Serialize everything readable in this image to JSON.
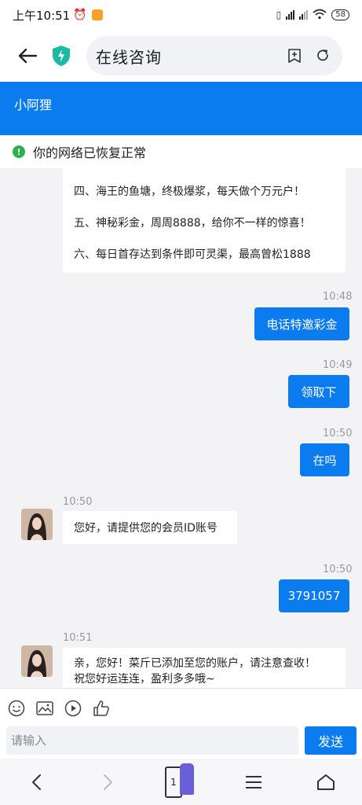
{
  "status_bar": {
    "time": "上午10:51",
    "battery": "58"
  },
  "browser": {
    "title": "在线咨询"
  },
  "chat": {
    "header_title": "小阿狸",
    "network_notice": "你的网络已恢复正常",
    "promo_lines": [
      "四、海王的鱼塘，终极爆浆，每天做个万元户！",
      "五、神秘彩金，周周8888，给你不一样的惊喜！",
      "六、每日首存达到条件即可灵渠，最高曾松1888"
    ],
    "messages": [
      {
        "time": "10:48",
        "text": "电话特邀彩金"
      },
      {
        "time": "10:49",
        "text": "领取下"
      },
      {
        "time": "10:50",
        "text": "在吗"
      },
      {
        "time": "10:50",
        "text": "您好，请提供您的会员ID账号"
      },
      {
        "time": "10:50",
        "text": "3791057"
      },
      {
        "time": "10:51",
        "text": "亲，您好！菜斤已添加至您的账户，请注意查收！"
      },
      {
        "text": "祝您好运连连，盈利多多哦~"
      }
    ]
  },
  "composer": {
    "placeholder": "请输入",
    "send_label": "发送"
  },
  "bottom_nav": {
    "tab_count": "1"
  }
}
